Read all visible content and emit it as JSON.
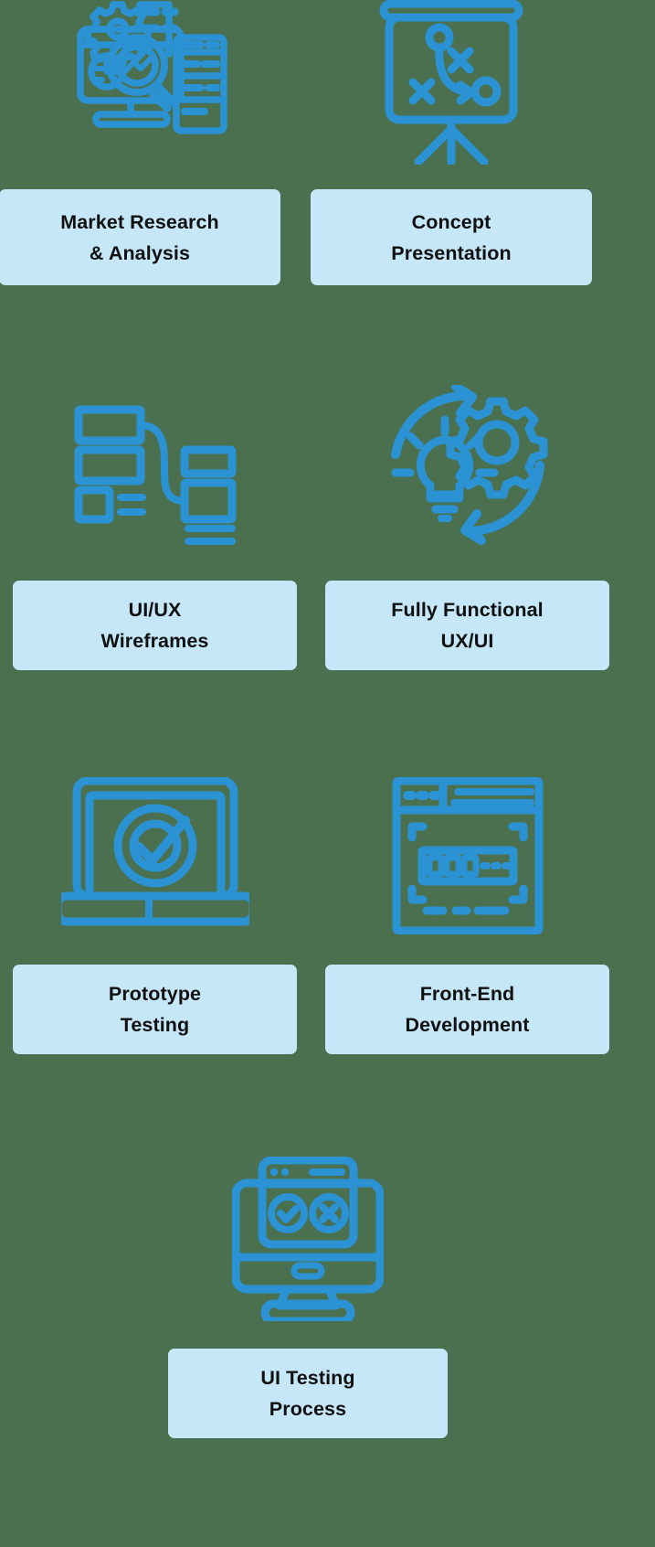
{
  "page": {
    "background_color": "#4a7050",
    "card_color": "#c5e7f8",
    "icon_color": "#2b92d4",
    "text_color": "#111111"
  },
  "steps": [
    {
      "id": "market-research",
      "icon": "market-research-dashboard-icon",
      "label_lines": [
        "Market Research",
        "& Analysis"
      ]
    },
    {
      "id": "concept-presentation",
      "icon": "presentation-board-strategy-icon",
      "label_lines": [
        "Concept",
        "Presentation"
      ]
    },
    {
      "id": "ui-ux-wireframes",
      "icon": "wireframe-blocks-icon",
      "label_lines": [
        "UI/UX",
        "Wireframes"
      ]
    },
    {
      "id": "fully-functional-ux-ui",
      "icon": "lightbulb-gear-cycle-icon",
      "label_lines": [
        "Fully Functional",
        "UX/UI"
      ]
    },
    {
      "id": "prototype-testing",
      "icon": "laptop-target-check-icon",
      "label_lines": [
        "Prototype",
        "Testing"
      ]
    },
    {
      "id": "front-end-development",
      "icon": "browser-layout-code-icon",
      "label_lines": [
        "Front-End",
        "Development"
      ]
    },
    {
      "id": "ui-testing-process",
      "icon": "monitor-pass-fail-icon",
      "label_lines": [
        "UI Testing",
        "Process"
      ]
    }
  ]
}
